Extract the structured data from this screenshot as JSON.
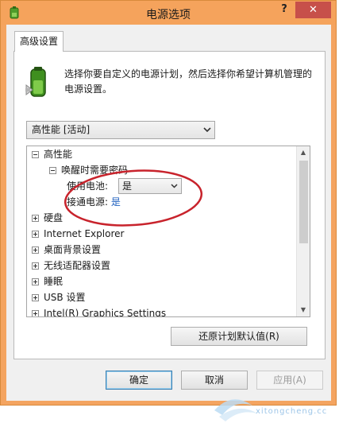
{
  "window": {
    "title": "电源选项",
    "help_label": "?",
    "close_label": "✕"
  },
  "tab": {
    "label": "高级设置"
  },
  "description": "选择你要自定义的电源计划，然后选择你希望计算机管理的电源设置。",
  "plan_select": {
    "value": "高性能 [活动]"
  },
  "tree": {
    "items": [
      {
        "label": "高性能",
        "expanded": true
      },
      {
        "label": "唤醒时需要密码",
        "expanded": true
      },
      {
        "label": "使用电池:",
        "value": "是"
      },
      {
        "label": "接通电源:",
        "value": "是"
      },
      {
        "label": "硬盘"
      },
      {
        "label": "Internet Explorer"
      },
      {
        "label": "桌面背景设置"
      },
      {
        "label": "无线适配器设置"
      },
      {
        "label": "睡眠"
      },
      {
        "label": "USB 设置"
      },
      {
        "label": "Intel(R) Graphics Settings"
      }
    ]
  },
  "buttons": {
    "restore": "还原计划默认值(R)",
    "ok": "确定",
    "cancel": "取消",
    "apply": "应用(A)"
  },
  "watermark": {
    "text": "xitongcheng.cc"
  },
  "colors": {
    "titlebar": "#f5a35c",
    "close": "#c7504a",
    "highlight_ring": "#c8232c",
    "link": "#1e5fbf"
  }
}
